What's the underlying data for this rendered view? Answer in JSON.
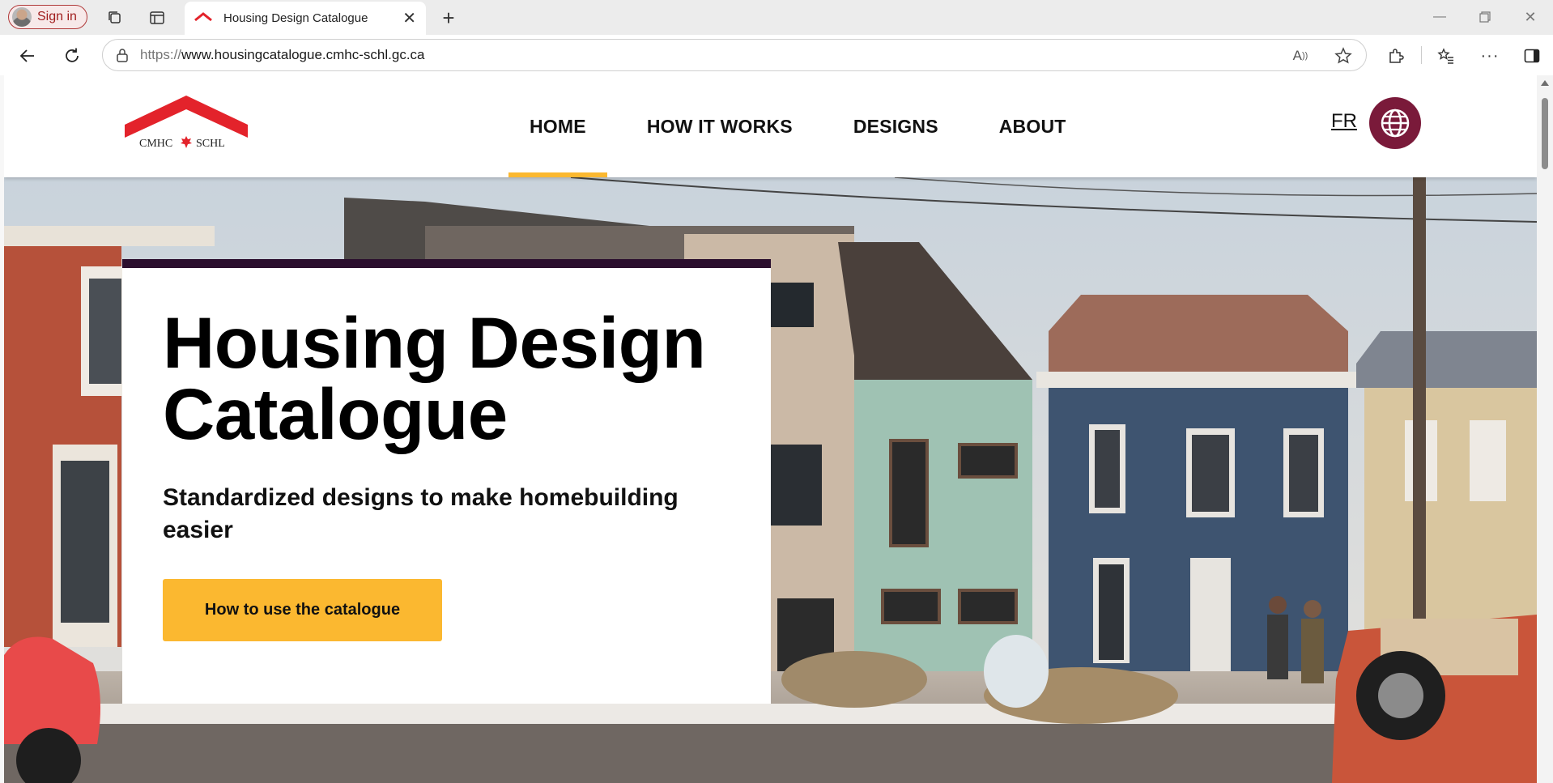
{
  "browser": {
    "signin_label": "Sign in",
    "tab_title": "Housing Design Catalogue",
    "url_protocol": "https://",
    "url_host": "www.housingcatalogue.cmhc-schl.gc.ca"
  },
  "site": {
    "logo_text": "CMHC ✚ SCHL",
    "nav": [
      {
        "label": "HOME",
        "active": true
      },
      {
        "label": "HOW IT WORKS",
        "active": false
      },
      {
        "label": "DESIGNS",
        "active": false
      },
      {
        "label": "ABOUT",
        "active": false
      }
    ],
    "lang_toggle": "FR"
  },
  "hero": {
    "title": "Housing Design Catalogue",
    "subtitle": "Standardized designs to make homebuilding easier",
    "cta_label": "How to use the catalogue"
  },
  "colors": {
    "accent_yellow": "#fbb830",
    "card_border": "#2b0f2e",
    "globe_bg": "#7a1a3a",
    "logo_red": "#e3232b"
  },
  "icons": [
    "collections-icon",
    "sidebar-tab-icon",
    "cmhc-tab-icon",
    "close-icon",
    "plus-icon",
    "back-arrow-icon",
    "refresh-icon",
    "lock-icon",
    "read-aloud-icon",
    "favorite-star-icon",
    "extensions-icon",
    "favorites-list-icon",
    "more-icon",
    "sidebar-toggle-icon",
    "globe-icon"
  ]
}
